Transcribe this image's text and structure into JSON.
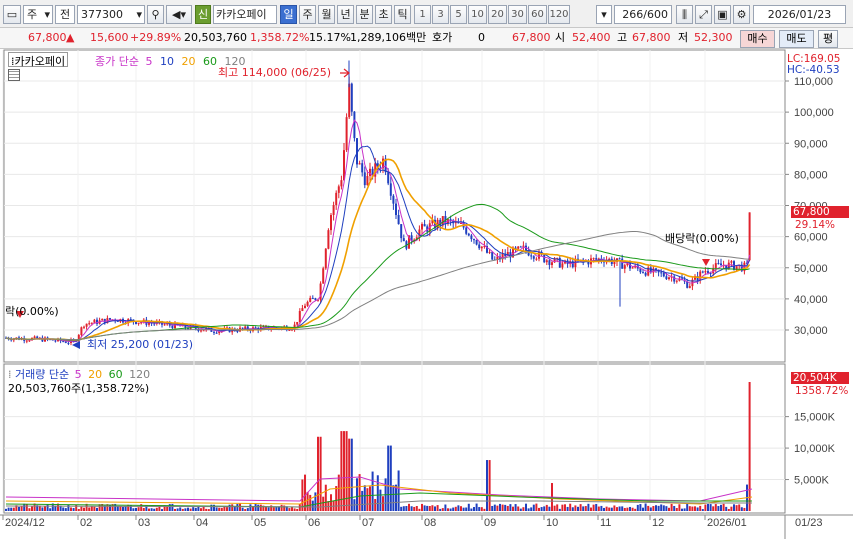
{
  "toolbar": {
    "market_label": "주",
    "prev_label": "전",
    "code": "377300",
    "new_badge": "신",
    "stock_name": "카카오페이",
    "periods": [
      "일",
      "주",
      "월",
      "년",
      "분",
      "초",
      "틱"
    ],
    "active_period": "일",
    "numbers": [
      "1",
      "3",
      "5",
      "10",
      "20",
      "30",
      "60",
      "120"
    ],
    "count": "266",
    "count_total": "/600",
    "date": "2026/01/23"
  },
  "infobar": {
    "price": "67,800",
    "change": "15,600",
    "change_pct": "+29.89%",
    "volume": "20,503,760",
    "volume_pct": "1,358.72%",
    "turnover": "15.17%",
    "amount": "1,289,106백만",
    "quote_label": "호가",
    "quote_value": "0",
    "last": "67,800",
    "open_label": "시",
    "open": "52,400",
    "high_label": "고",
    "high": "67,800",
    "low_label": "저",
    "low": "52,300",
    "buy_label": "매수",
    "sell_label": "매도",
    "eval_label": "평"
  },
  "price_panel": {
    "name_tag": "카카오페이",
    "legend_prefix": "종가 단순",
    "ma_labels": [
      "5",
      "10",
      "20",
      "60",
      "120"
    ],
    "ma_colors": [
      "#c832c8",
      "#1f3fbf",
      "#f0a000",
      "#1a9a1a",
      "#808080"
    ],
    "lc": "LC:169.05",
    "hc": "HC:-40.53",
    "high_note": "최고 114,000 (06/25)",
    "low_note": "최저 25,200 (01/23)",
    "div_note_left": "락(0.00%)",
    "div_note_right": "배당락(0.00%)",
    "price_tag": "67,800",
    "price_tag_pct": "29.14%",
    "y_ticks": [
      "110,000",
      "100,000",
      "90,000",
      "80,000",
      "70,000",
      "60,000",
      "50,000",
      "40,000",
      "30,000"
    ]
  },
  "volume_panel": {
    "title": "거래량 단순",
    "ma_labels": [
      "5",
      "20",
      "60",
      "120"
    ],
    "ma_colors": [
      "#c832c8",
      "#f0a000",
      "#1a9a1a",
      "#808080"
    ],
    "value_line": "20,503,760주(1,358.72%)",
    "tag": "20,504K",
    "tag_pct": "1358.72%",
    "y_ticks": [
      "15,000K",
      "10,000K",
      "5,000K"
    ]
  },
  "x_axis": {
    "labels": [
      "2024/12",
      "02",
      "03",
      "04",
      "05",
      "06",
      "07",
      "08",
      "09",
      "10",
      "11",
      "12",
      "2026/01",
      "01/23"
    ]
  },
  "colors": {
    "up": "#e0222d",
    "down": "#1f3fbf",
    "accent": "#3b6fd0"
  }
}
